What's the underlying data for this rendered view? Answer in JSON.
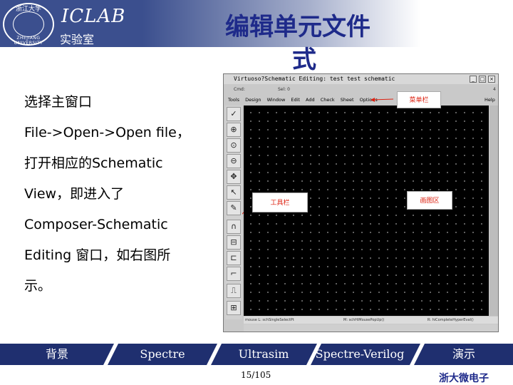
{
  "header": {
    "logo_text": "ICLAB",
    "lab_name": "实验室",
    "seal_top_text": "浙江大学",
    "seal_bottom_text": "ZHEJIANG UNIVERSITY",
    "title_line1": "编辑单元文件",
    "title_line2": "式"
  },
  "description": [
    "选择主窗口",
    "File->Open->Open file，",
    "打开相应的Schematic",
    "View，即进入了",
    "Composer-Schematic",
    "Editing 窗口，如右图所",
    "示。"
  ],
  "window": {
    "title": "Virtuoso?Schematic Editing: test test schematic",
    "row2_left": "Cmd:",
    "row2_mid": "Sel: 0",
    "row2_right": "4",
    "menus": [
      "Tools",
      "Design",
      "Window",
      "Edit",
      "Add",
      "Check",
      "Sheet",
      "Options"
    ],
    "help_label": "Help",
    "status_left": "mouse L: schSingleSelectPt",
    "status_mid": "M: schHiMousePopUp()",
    "status_right": "R: hiCompleteHyperEval()",
    "callouts": {
      "menubar": "菜单栏",
      "toolbar": "工具栏",
      "canvas": "画图区"
    },
    "tool_icons": [
      "check-icon",
      "select-icon",
      "zoom-in-icon",
      "zoom-out-icon",
      "pan-icon",
      "pointer-icon",
      "pen-icon",
      "arc-icon",
      "component-icon",
      "port-icon",
      "wire-icon",
      "label-icon",
      "probe-icon"
    ]
  },
  "footer": {
    "nav": [
      "背景",
      "Spectre",
      "Ultrasim",
      "Spectre-Verilog",
      "演示"
    ],
    "page": "15/105",
    "university": "浙大微电子"
  },
  "colors": {
    "header_blue": "#3b4f8e",
    "title_blue": "#1e2a8a",
    "footer_navy": "#1f2f6f",
    "canvas_black": "#000000",
    "callout_red": "#dd2211"
  }
}
